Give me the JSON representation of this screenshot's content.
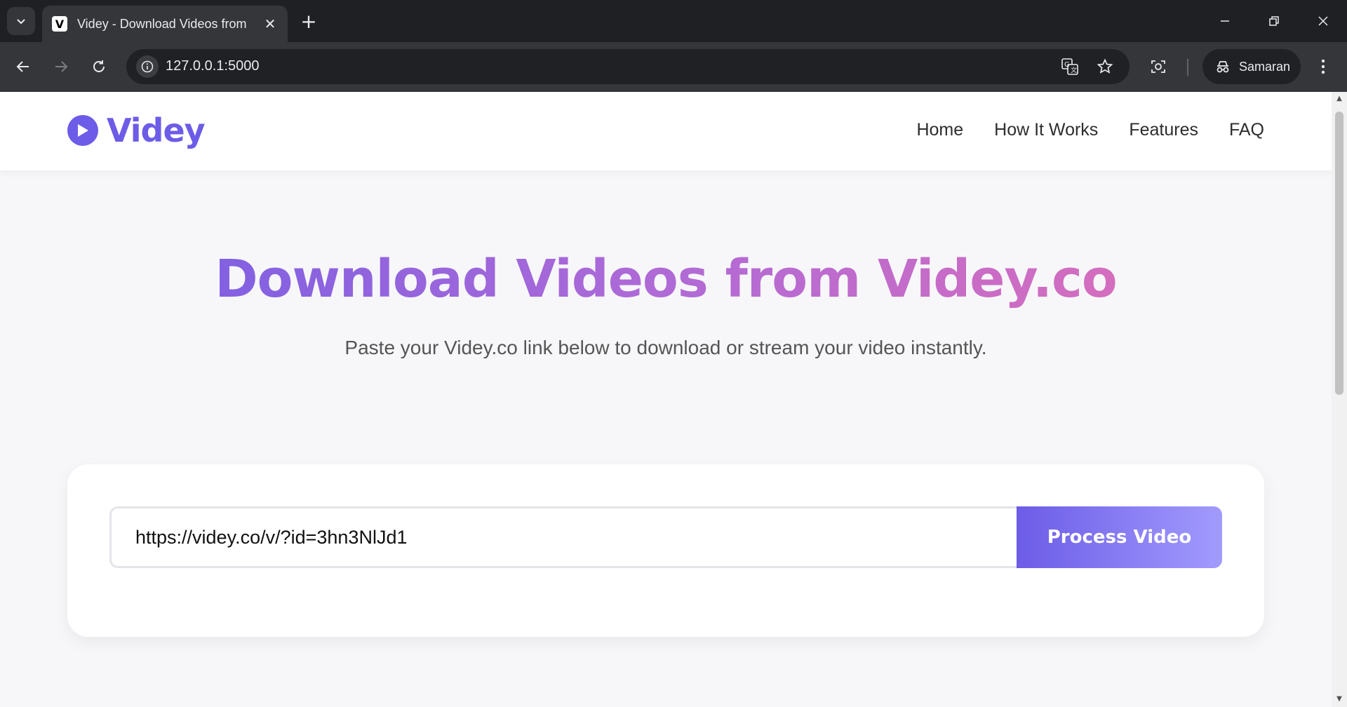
{
  "browser": {
    "tab_title": "Videy - Download Videos from",
    "favicon_letter": "V",
    "url": "127.0.0.1:5000",
    "profile_name": "Samaran",
    "icons": {
      "tab_menu": "chevron-down-icon",
      "close": "close-icon",
      "new_tab": "plus-icon",
      "back": "arrow-left-icon",
      "forward": "arrow-right-icon",
      "reload": "reload-icon",
      "site_info": "info-icon",
      "translate": "translate-icon",
      "bookmark": "star-icon",
      "lens": "lens-icon",
      "incognito": "incognito-icon",
      "menu": "kebab-menu-icon"
    }
  },
  "site": {
    "logo_text": "Videy",
    "nav": [
      "Home",
      "How It Works",
      "Features",
      "FAQ"
    ],
    "hero_title": "Download Videos from Videy.co",
    "hero_subtitle": "Paste your Videy.co link below to download or stream your video instantly.",
    "input_value": "https://videy.co/v/?id=3hn3NlJd1",
    "process_button": "Process Video",
    "colors": {
      "brand": "#6c5ce7",
      "gradient_end": "#e56fb3",
      "button_gradient_end": "#a29bfe"
    }
  }
}
